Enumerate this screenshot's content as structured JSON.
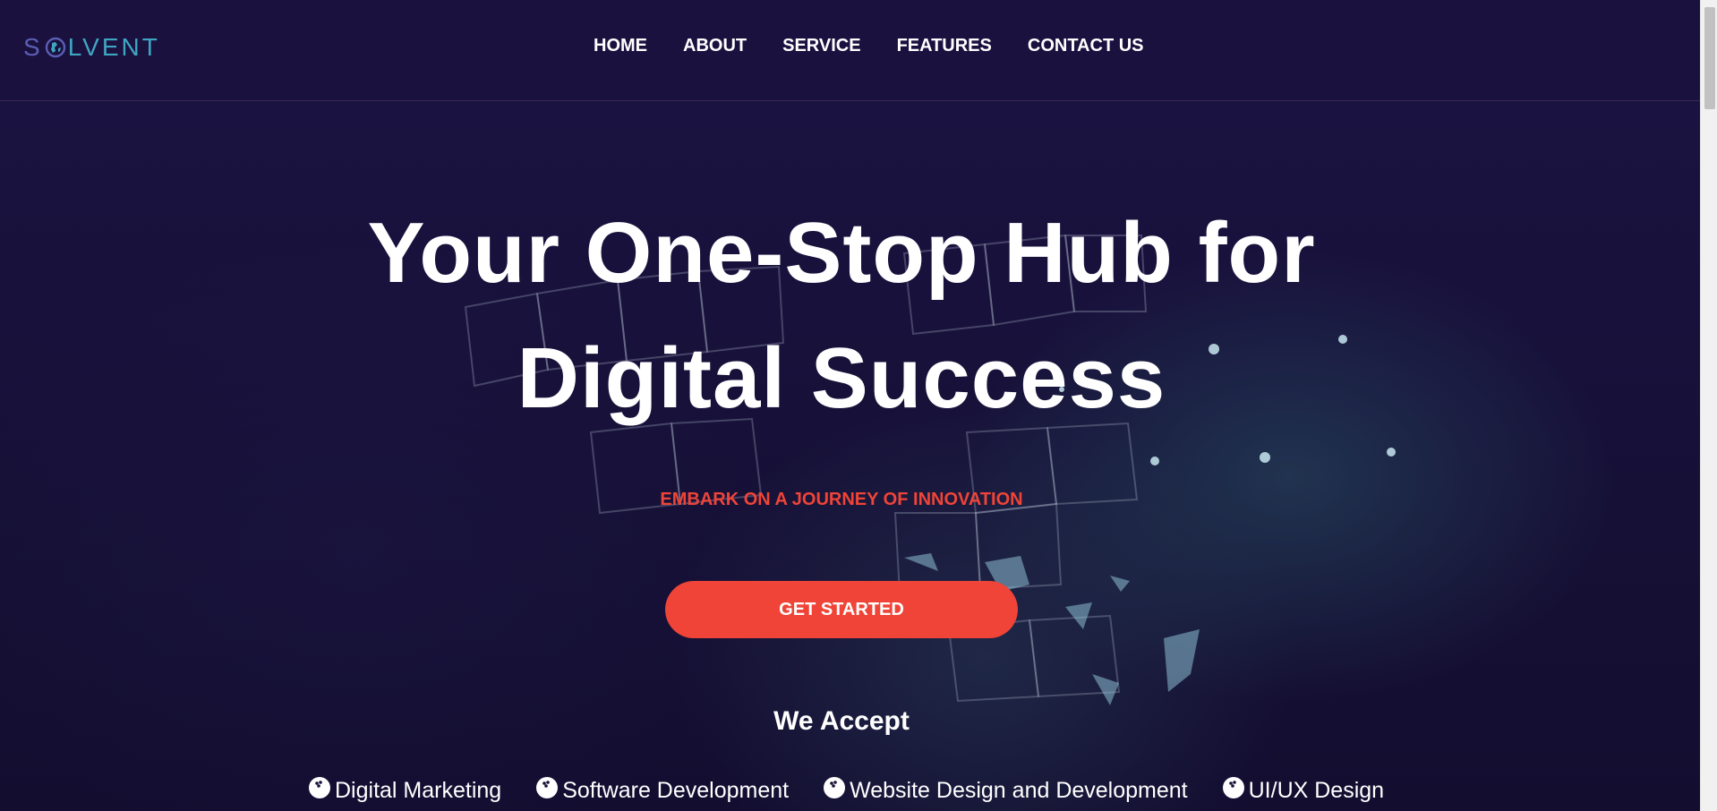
{
  "brand": {
    "logo_part1": "S",
    "logo_part2": "LVENT",
    "logo_icon": "globe-icon",
    "colors": {
      "logo_primary": "#5a5fb5",
      "logo_secondary": "#3fa6c2"
    }
  },
  "nav": {
    "items": [
      {
        "label": "HOME"
      },
      {
        "label": "ABOUT"
      },
      {
        "label": "SERVICE"
      },
      {
        "label": "FEATURES"
      },
      {
        "label": "CONTACT US"
      }
    ]
  },
  "hero": {
    "title_line1": "Your One-Stop Hub for",
    "title_line2": "Digital Success",
    "tagline": "EMBARK ON A JOURNEY OF INNOVATION",
    "cta_label": "GET STARTED",
    "accept_title": "We Accept",
    "services": [
      {
        "label": "Digital Marketing",
        "icon": "bowling-ball-icon"
      },
      {
        "label": "Software Development",
        "icon": "bowling-ball-icon"
      },
      {
        "label": "Website Design and Development",
        "icon": "bowling-ball-icon"
      },
      {
        "label": "UI/UX Design",
        "icon": "bowling-ball-icon"
      }
    ]
  },
  "colors": {
    "background": "#160f36",
    "header": "#1b113f",
    "accent": "#ef4437",
    "text": "#ffffff"
  }
}
